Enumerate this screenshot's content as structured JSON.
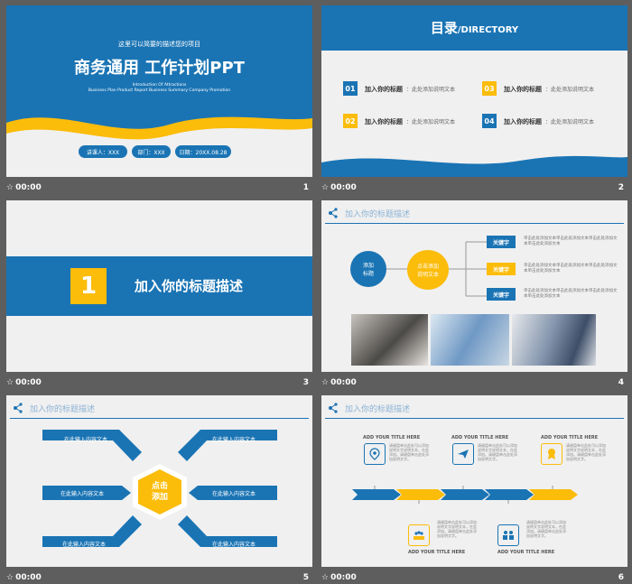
{
  "slides": [
    {
      "number": "1",
      "time": "00:00",
      "subtitle_small": "这里可以简要的描述您的项目",
      "title": "商务通用 工作计划PPT",
      "english_1": "Introduction Of Attractions",
      "english_2": "Business Plan Product Report Business Summary Company Promotion",
      "pills": [
        "讲课人：XXX",
        "部门：XXX",
        "日期：20XX.08.28"
      ]
    },
    {
      "number": "2",
      "time": "00:00",
      "title_cn": "目录",
      "title_en": "/DIRECTORY",
      "items": [
        {
          "num": "01",
          "label": "加入你的标题",
          "desc": "：此处添加说明文本"
        },
        {
          "num": "03",
          "label": "加入你的标题",
          "desc": "：此处添加说明文本"
        },
        {
          "num": "02",
          "label": "加入你的标题",
          "desc": "：此处添加说明文本"
        },
        {
          "num": "04",
          "label": "加入你的标题",
          "desc": "：此处添加说明文本"
        }
      ]
    },
    {
      "number": "3",
      "time": "00:00",
      "section_num": "1",
      "section_title": "加入你的标题描述"
    },
    {
      "number": "4",
      "time": "00:00",
      "header": "加入你的标题描述",
      "circle_left": "添加\n标题",
      "circle_right": "点击添加\n说明文本",
      "keywords": [
        "关键字",
        "关键字",
        "关键字"
      ],
      "kw_text": "单击此处添加文本单击此处添加文本单击此处添加文本单击此处添加文本"
    },
    {
      "number": "5",
      "time": "00:00",
      "header": "加入你的标题描述",
      "center_text": "点击\n添加",
      "arrow_text": "在此输入内容文本"
    },
    {
      "number": "6",
      "time": "00:00",
      "header": "加入你的标题描述",
      "ttl": "ADD YOUR TITLE HERE",
      "body": "请键盘单击此处可以添加说明文字说明文本，在此添加。请键盘单击此处添加说明文字。"
    }
  ],
  "colors": {
    "blue": "#1a74b4",
    "yellow": "#fbbc0a",
    "gray_bg": "#5e5e5e"
  }
}
